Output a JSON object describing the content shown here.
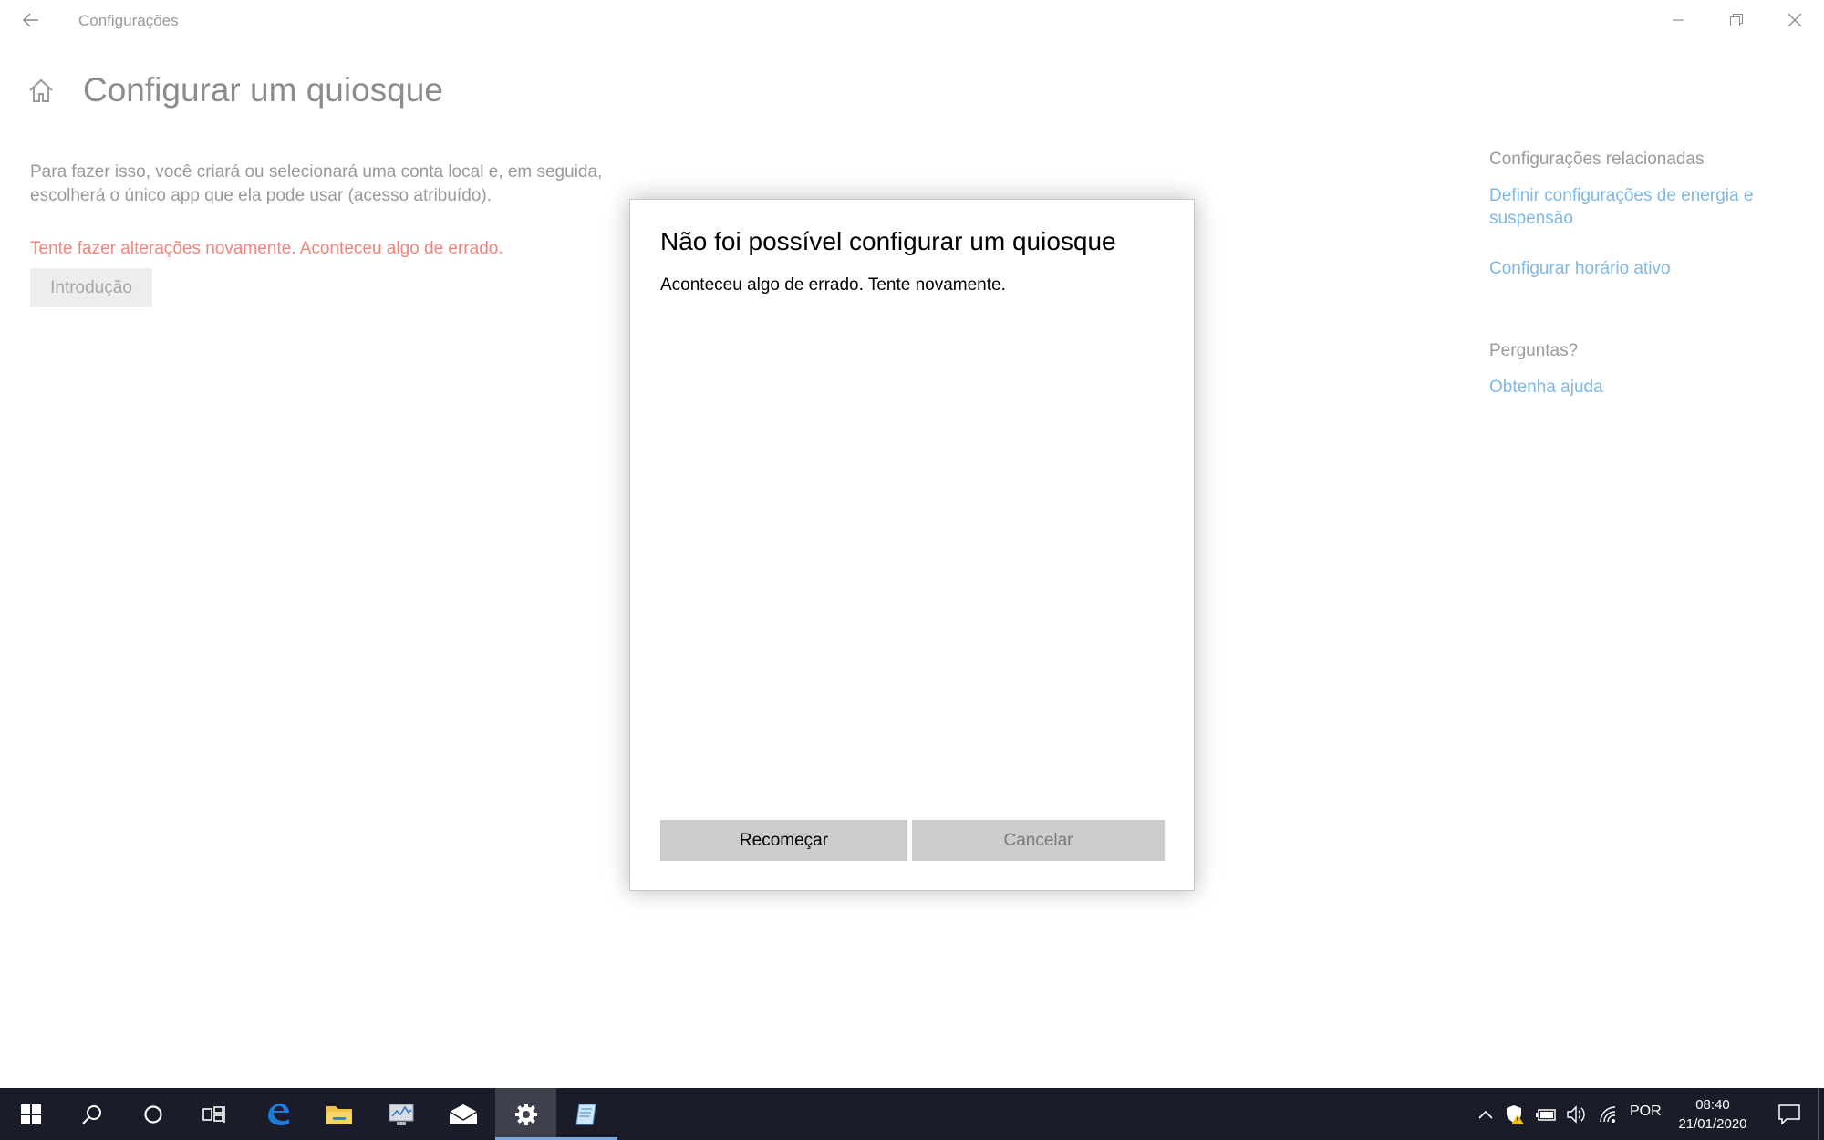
{
  "window": {
    "title": "Configurações"
  },
  "page": {
    "title": "Configurar um quiosque",
    "description": "Para fazer isso, você criará ou selecionará uma conta local e, em seguida, escolherá o único app que ela pode usar (acesso atribuído).",
    "error": "Tente fazer alterações novamente. Aconteceu algo de errado.",
    "intro_button": "Introdução"
  },
  "related": {
    "heading": "Configurações relacionadas",
    "links": [
      "Definir configurações de energia e suspensão",
      "Configurar horário ativo"
    ],
    "questions_heading": "Perguntas?",
    "help_link": "Obtenha ajuda"
  },
  "dialog": {
    "title": "Não foi possível configurar um quiosque",
    "message": "Aconteceu algo de errado. Tente novamente.",
    "restart_button": "Recomeçar",
    "cancel_button": "Cancelar"
  },
  "taskbar": {
    "apps": [
      "start-icon",
      "search-icon",
      "cortana-icon",
      "task-view-icon",
      "edge-icon",
      "file-explorer-icon",
      "performance-monitor-icon",
      "mail-icon",
      "settings-icon",
      "notepad-icon"
    ],
    "active_app": "settings-icon",
    "language": "POR",
    "time": "08:40",
    "date": "21/01/2020"
  },
  "colors": {
    "error_text": "#f0857f",
    "link": "#7fb8e5",
    "taskbar": "#1a1d29"
  }
}
